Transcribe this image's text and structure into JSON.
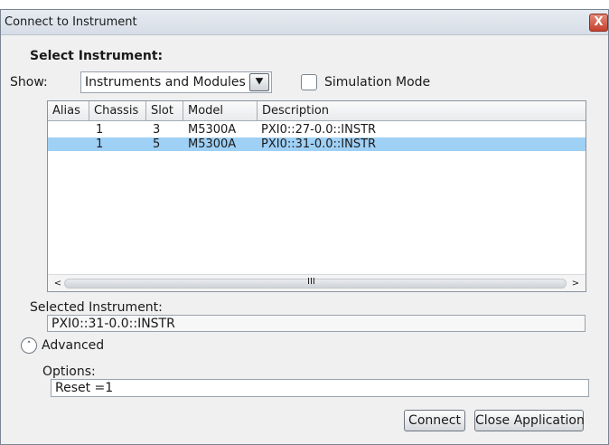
{
  "window": {
    "title": "Connect to Instrument",
    "close_glyph": "X"
  },
  "select_instrument": {
    "heading": "Select Instrument:",
    "show_label": "Show:",
    "show_value": "Instruments and Modules",
    "show_arrow_icon": "chevron-down-icon",
    "simulation_mode_label": "Simulation Mode",
    "simulation_mode_checked": false
  },
  "grid": {
    "columns": [
      "Alias",
      "Chassis",
      "Slot",
      "Model",
      "Description"
    ],
    "rows": [
      {
        "alias": "",
        "chassis": "1",
        "slot": "3",
        "model": "M5300A",
        "description": "PXI0::27-0.0::INSTR",
        "selected": false
      },
      {
        "alias": "",
        "chassis": "1",
        "slot": "5",
        "model": "M5300A",
        "description": "PXI0::31-0.0::INSTR",
        "selected": true
      }
    ],
    "scroll_left_glyph": "<",
    "scroll_right_glyph": ">",
    "scroll_grip_glyph": "III"
  },
  "selected_instrument": {
    "label": "Selected Instrument:",
    "value": "PXI0::31-0.0::INSTR"
  },
  "advanced": {
    "label": "Advanced",
    "icon": "chevron-up-circle-icon"
  },
  "options": {
    "label": "Options:",
    "value": "Reset =1"
  },
  "buttons": {
    "connect": "Connect",
    "close_application": "Close Application"
  },
  "colors": {
    "selected_row": "#9fd0f5",
    "close_button": "#c5402d"
  }
}
